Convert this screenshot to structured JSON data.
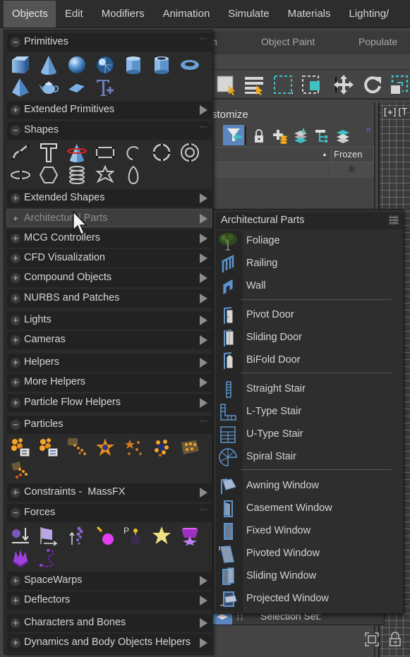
{
  "menubar": {
    "items": [
      "Objects",
      "Edit",
      "Modifiers",
      "Animation",
      "Simulate",
      "Materials",
      "Lighting/"
    ],
    "active_index": 0
  },
  "background": {
    "ribbon_tabs": [
      "n",
      "Object Paint",
      "Populate"
    ],
    "scene_explorer_title": "stomize",
    "column_frozen": "Frozen",
    "frozen_cell_icon": "snowflake-icon",
    "viewport_label": "[+][T",
    "selection_set_label": "Selection Set:"
  },
  "dropdown": {
    "sections": [
      {
        "label": "Primitives",
        "expanded": true,
        "icons": [
          "box-icon",
          "cone-icon",
          "sphere-icon",
          "geosphere-icon",
          "cylinder-icon",
          "tube-icon",
          "torus-icon",
          "pyramid-icon",
          "teapot-icon",
          "plane-icon",
          "text-plus-icon"
        ]
      },
      {
        "label": "Extended Primitives",
        "expanded": false
      },
      {
        "label": "Shapes",
        "expanded": true,
        "icons": [
          "line-icon",
          "text-shape-icon",
          "section-icon",
          "rectangle-icon",
          "arc-icon",
          "circle-icon",
          "donut-icon",
          "ellipse-icon",
          "ngon-icon",
          "helix-icon",
          "star-icon",
          "egg-icon"
        ]
      },
      {
        "label": "Extended Shapes",
        "expanded": false
      },
      {
        "label": "Architectural Parts",
        "expanded": false,
        "hovered": true
      },
      {
        "label": "MCG Controllers",
        "expanded": false
      },
      {
        "label": "CFD Visualization",
        "expanded": false
      },
      {
        "label": "Compound Objects",
        "expanded": false
      },
      {
        "label": "NURBS and Patches",
        "expanded": false
      },
      {
        "label": "Lights",
        "expanded": false
      },
      {
        "label": "Cameras",
        "expanded": false
      },
      {
        "label": "Helpers",
        "expanded": false
      },
      {
        "label": "More Helpers",
        "expanded": false
      },
      {
        "label": "Particle Flow Helpers",
        "expanded": false
      },
      {
        "label": "Particles",
        "expanded": true,
        "icons": [
          "pf-source-icon",
          "pf-source-list-icon",
          "spray-icon",
          "snow-icon",
          "super-spray-icon",
          "blizzard-icon",
          "parray-icon",
          "pcloud-icon"
        ]
      },
      {
        "label": "Constraints -  MassFX",
        "expanded": false
      },
      {
        "label": "Forces",
        "expanded": true,
        "icons": [
          "gravity-icon",
          "wind-icon",
          "drag-icon",
          "motor-icon",
          "pbomb-icon",
          "push-icon",
          "vortex-icon",
          "displace-icon",
          "path-follow-icon"
        ]
      },
      {
        "label": "SpaceWarps",
        "expanded": false
      },
      {
        "label": "Deflectors",
        "expanded": false
      },
      {
        "label": "Characters and Bones",
        "expanded": false
      },
      {
        "label": "Dynamics and Body Objects Helpers",
        "expanded": false
      }
    ]
  },
  "submenu": {
    "title": "Architectural Parts",
    "groups": [
      [
        {
          "label": "Foliage",
          "icon": "foliage-icon"
        },
        {
          "label": "Railing",
          "icon": "railing-icon"
        },
        {
          "label": "Wall",
          "icon": "wall-icon"
        }
      ],
      [
        {
          "label": "Pivot Door",
          "icon": "pivot-door-icon"
        },
        {
          "label": "Sliding Door",
          "icon": "sliding-door-icon"
        },
        {
          "label": "BiFold Door",
          "icon": "bifold-door-icon"
        }
      ],
      [
        {
          "label": "Straight Stair",
          "icon": "straight-stair-icon"
        },
        {
          "label": "L-Type Stair",
          "icon": "l-type-stair-icon"
        },
        {
          "label": "U-Type Stair",
          "icon": "u-type-stair-icon"
        },
        {
          "label": "Spiral Stair",
          "icon": "spiral-stair-icon"
        }
      ],
      [
        {
          "label": "Awning Window",
          "icon": "awning-window-icon"
        },
        {
          "label": "Casement Window",
          "icon": "casement-window-icon"
        },
        {
          "label": "Fixed Window",
          "icon": "fixed-window-icon"
        },
        {
          "label": "Pivoted Window",
          "icon": "pivoted-window-icon"
        },
        {
          "label": "Sliding Window",
          "icon": "sliding-window-icon"
        },
        {
          "label": "Projected Window",
          "icon": "projected-window-icon"
        }
      ]
    ]
  }
}
